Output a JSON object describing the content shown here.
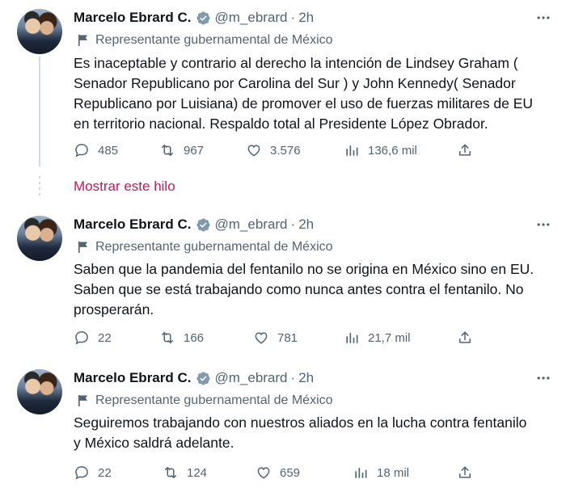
{
  "colors": {
    "accent_link": "#c2185b",
    "muted": "#536471",
    "text": "#0f1419",
    "verified": "#829aab"
  },
  "show_thread_label": "Mostrar este hilo",
  "tweets": [
    {
      "author_name": "Marcelo Ebrard C.",
      "handle": "@m_ebrard",
      "dot": "·",
      "time": "2h",
      "label": "Representante gubernamental de México",
      "lines": [
        "Es inaceptable y contrario al derecho la intención de Lindsey Graham (",
        "Senador Republicano por Carolina del Sur ) y John Kennedy( Senador",
        "Republicano por Luisiana) de promover el uso de fuerzas militares de EU",
        "en territorio nacional. Respaldo total al Presidente López Obrador."
      ],
      "replies": "485",
      "retweets": "967",
      "likes": "3.576",
      "views": "136,6 mil"
    },
    {
      "author_name": "Marcelo Ebrard C.",
      "handle": "@m_ebrard",
      "dot": "·",
      "time": "2h",
      "label": "Representante gubernamental de México",
      "lines": [
        "Saben que la pandemia del fentanilo no se origina en México sino en EU.",
        "Saben que se está trabajando como nunca antes contra el fentanilo. No",
        "prosperarán."
      ],
      "replies": "22",
      "retweets": "166",
      "likes": "781",
      "views": "21,7 mil"
    },
    {
      "author_name": "Marcelo Ebrard C.",
      "handle": "@m_ebrard",
      "dot": "·",
      "time": "2h",
      "label": "Representante gubernamental de México",
      "lines": [
        "Seguiremos trabajando con nuestros aliados en la lucha contra fentanilo",
        "y México saldrá adelante."
      ],
      "replies": "22",
      "retweets": "124",
      "likes": "659",
      "views": "18 mil"
    }
  ]
}
